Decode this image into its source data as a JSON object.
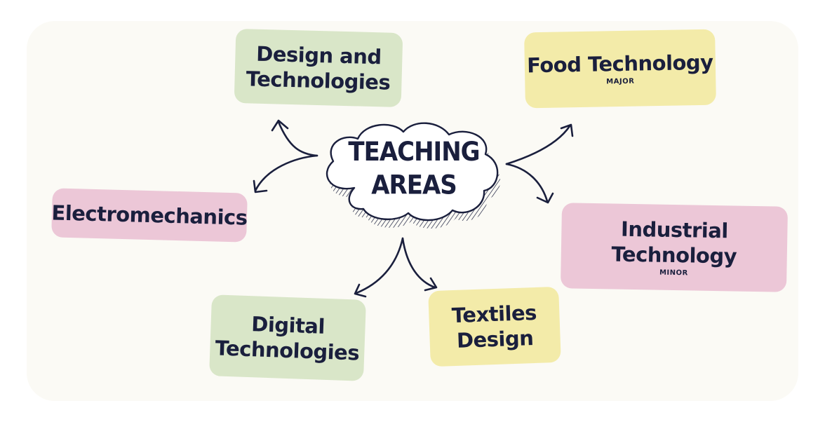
{
  "center": {
    "line1": "TEACHING",
    "line2": "AREAS"
  },
  "nodes": {
    "design_technologies": {
      "line1": "Design and",
      "line2": "Technologies",
      "color": "#d9e6c8"
    },
    "food_technology": {
      "line1": "Food Technology",
      "sub": "MAJOR",
      "color": "#f3eba9"
    },
    "electromechanics": {
      "line1": "Electromechanics",
      "color": "#ecc7d7"
    },
    "industrial_technology": {
      "line1": "Industrial",
      "line2": "Technology",
      "sub": "MINOR",
      "color": "#ecc7d7"
    },
    "digital_technologies": {
      "line1": "Digital",
      "line2": "Technologies",
      "color": "#d9e6c8"
    },
    "textiles_design": {
      "line1": "Textiles",
      "line2": "Design",
      "color": "#f3eba9"
    }
  }
}
